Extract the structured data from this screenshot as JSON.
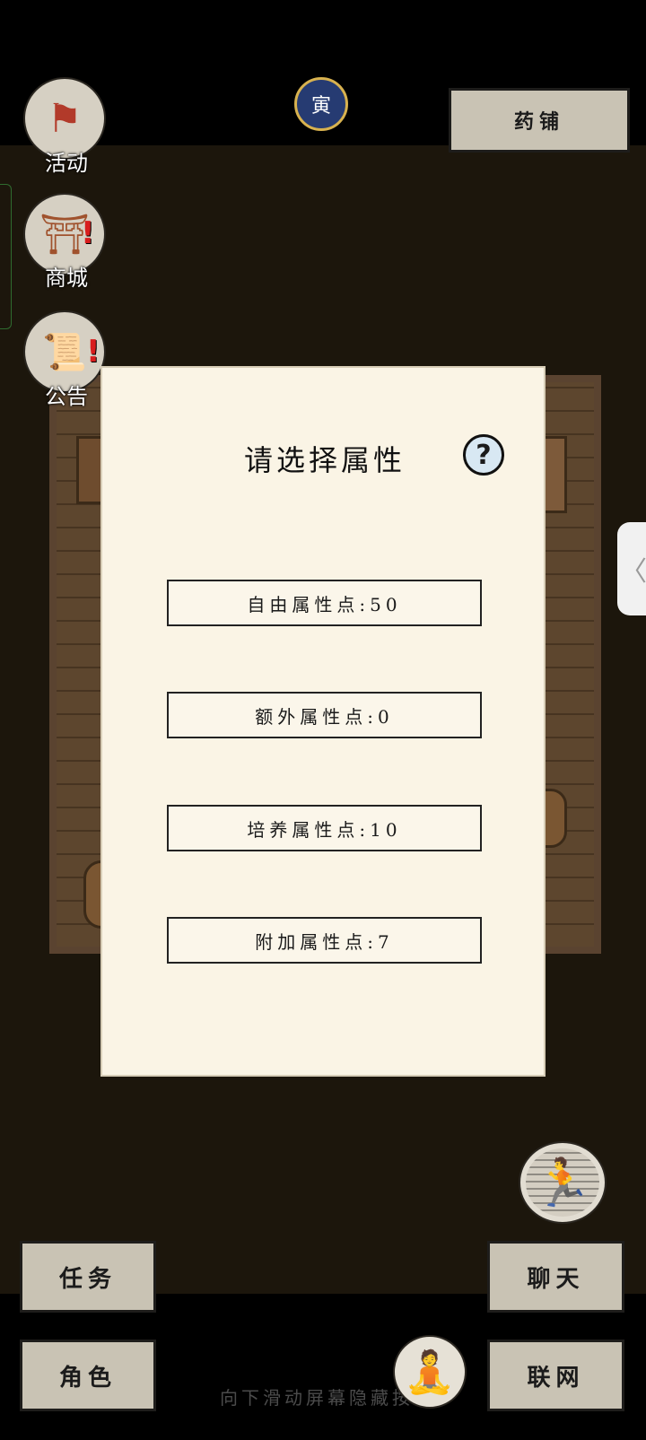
{
  "top_bar": {
    "shop_label": "药铺",
    "moon_glyph": "寅"
  },
  "left_menu": {
    "items": [
      {
        "label": "活动",
        "icon": "flag-scroll-icon",
        "glyph": "⚑",
        "alert": ""
      },
      {
        "label": "商城",
        "icon": "shop-stall-icon",
        "glyph": "⛩",
        "alert": "!"
      },
      {
        "label": "公告",
        "icon": "notice-board-icon",
        "glyph": "📜",
        "alert": "!"
      }
    ]
  },
  "side_tab_glyph": "〈",
  "modal": {
    "title": "请选择属性",
    "help_glyph": "?",
    "attributes": [
      {
        "label": "自由属性点:50"
      },
      {
        "label": "额外属性点:0"
      },
      {
        "label": "培养属性点:10"
      },
      {
        "label": "附加属性点:7"
      }
    ]
  },
  "bottom_bar": {
    "quest_label": "任务",
    "character_label": "角色",
    "chat_label": "聊天",
    "network_label": "联网",
    "run_glyph": "🏃",
    "meditate_glyph": "🧘",
    "hint_text": "向下滑动屏幕隐藏按"
  }
}
